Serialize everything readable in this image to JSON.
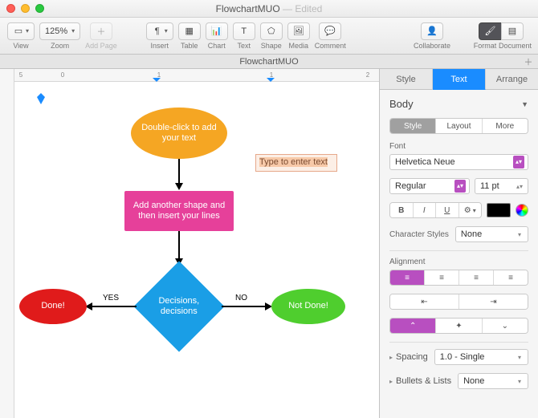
{
  "titlebar": {
    "doc_name": "FlowchartMUO",
    "edited": "— Edited",
    "icon_name": "pages-doc-icon"
  },
  "toolbar": {
    "view_label": "View",
    "zoom_label": "Zoom",
    "zoom_value": "125%",
    "addpage_label": "Add Page",
    "insert_label": "Insert",
    "table_label": "Table",
    "chart_label": "Chart",
    "text_label": "Text",
    "shape_label": "Shape",
    "media_label": "Media",
    "comment_label": "Comment",
    "collaborate_label": "Collaborate",
    "format_label": "Format",
    "document_label": "Document"
  },
  "doctab": {
    "name": "FlowchartMUO"
  },
  "ruler": {
    "h_labels": [
      "5",
      "0",
      "1",
      "1",
      "2"
    ]
  },
  "flowchart": {
    "start": "Double-click to add your text",
    "process": "Add another shape and then insert your lines",
    "decision": "Decisions, decisions",
    "done": "Done!",
    "notdone": "Not Done!",
    "edge_yes": "YES",
    "edge_no": "NO",
    "textbox": "Type to enter text"
  },
  "inspector": {
    "tabs": {
      "style": "Style",
      "text": "Text",
      "arrange": "Arrange"
    },
    "paragraph_style": "Body",
    "subtabs": {
      "style": "Style",
      "layout": "Layout",
      "more": "More"
    },
    "font_label": "Font",
    "font_family": "Helvetica Neue",
    "font_weight": "Regular",
    "font_size": "11 pt",
    "bold": "B",
    "italic": "I",
    "underline": "U",
    "gear": "⚙︎",
    "charstyles_label": "Character Styles",
    "charstyles_value": "None",
    "alignment_label": "Alignment",
    "spacing_label": "Spacing",
    "spacing_value": "1.0 - Single",
    "bullets_label": "Bullets & Lists",
    "bullets_value": "None"
  }
}
